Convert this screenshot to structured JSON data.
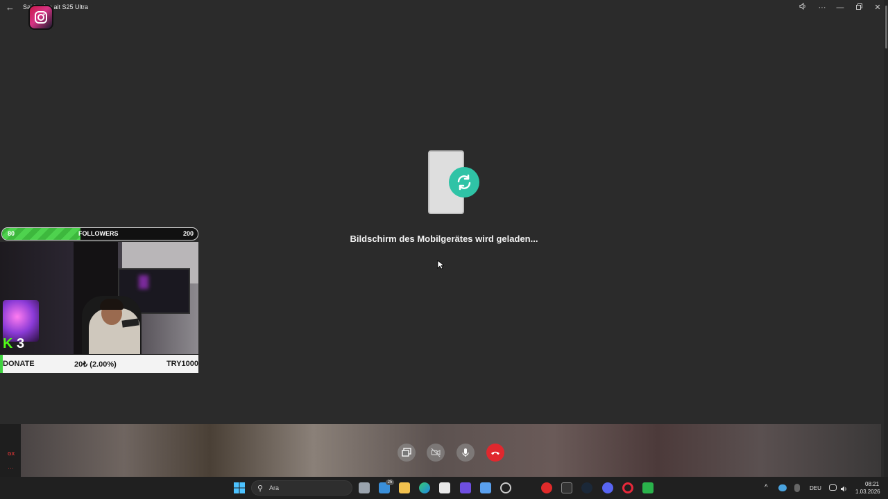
{
  "window": {
    "title": "Said ... iye ait S25 Ultra",
    "back_icon": "back-arrow-icon"
  },
  "window_controls": [
    {
      "name": "speaker-icon",
      "glyph": "🔈"
    },
    {
      "name": "more-icon",
      "glyph": "···"
    },
    {
      "name": "minimize-icon",
      "glyph": "—"
    },
    {
      "name": "restore-icon",
      "glyph": "❐"
    },
    {
      "name": "close-icon",
      "glyph": "✕"
    }
  ],
  "main": {
    "loading_text": "Bildschirm des Mobilgerätes wird geladen..."
  },
  "overlay": {
    "followers_goal": {
      "current": "80",
      "label": "FOLLOWERS",
      "target": "200",
      "progress": 0.4,
      "color": "#3db83d"
    },
    "kick_badge": {
      "letter": "K",
      "count": "3",
      "color": "#53fc18"
    },
    "donate_bar": {
      "label": "DONATE",
      "amount": "20₺ (2.00%)",
      "code": "TRY1000"
    }
  },
  "left_strip": {
    "gx": "GX",
    "dots": "···"
  },
  "call_controls": [
    {
      "name": "screen-share-button",
      "icon": "screen-share-icon"
    },
    {
      "name": "camera-off-button",
      "icon": "camera-off-icon"
    },
    {
      "name": "microphone-button",
      "icon": "microphone-icon"
    },
    {
      "name": "end-call-button",
      "icon": "phone-hangup-icon",
      "color": "#e0282e"
    }
  ],
  "taskbar": {
    "search_placeholder": "Ara",
    "badge": "25",
    "language": "DEU",
    "time": "08:21",
    "date": "1.03.2026"
  }
}
